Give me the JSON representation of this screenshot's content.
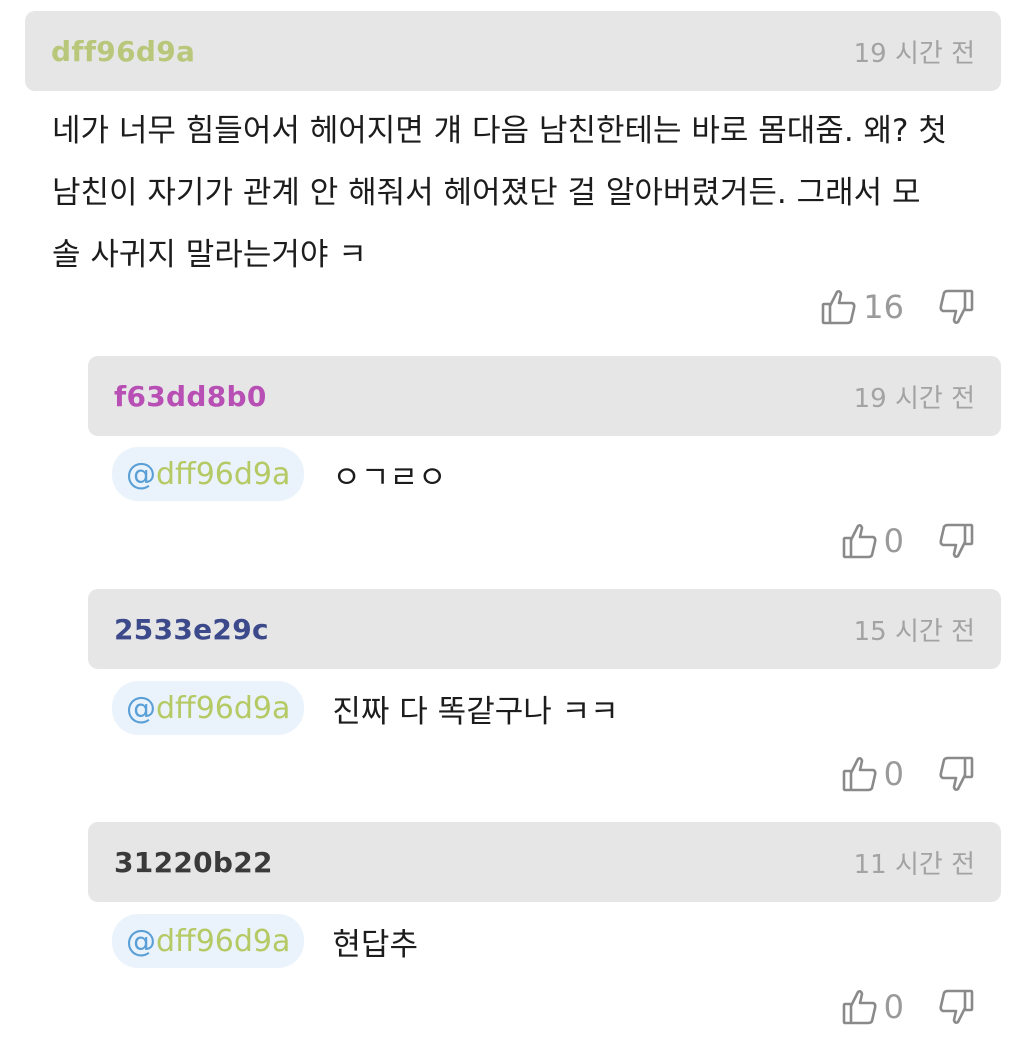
{
  "comments": [
    {
      "username": "dff96d9a",
      "username_color": "#b8c77a",
      "time": "19 시간 전",
      "lines": [
        "네가 너무 힘들어서 헤어지면 걔 다음 남친한테는 바로 몸대줌. 왜? 첫",
        "남친이 자기가 관계 안 해줘서 헤어졌단 걸 알아버렸거든. 그래서 모",
        "솔 사귀지 말라는거야 ㅋ"
      ],
      "likes": "16"
    }
  ],
  "replies": [
    {
      "username": "f63dd8b0",
      "username_color": "#b84fb5",
      "time": "19 시간 전",
      "mention_at": "@",
      "mention_name": "dff96d9a",
      "text": "ㅇㄱㄹㅇ",
      "likes": "0"
    },
    {
      "username": "2533e29c",
      "username_color": "#3c4a8c",
      "time": "15 시간 전",
      "mention_at": "@",
      "mention_name": "dff96d9a",
      "text": "진짜 다 똑같구나 ㅋㅋ",
      "likes": "0"
    },
    {
      "username": "31220b22",
      "username_color": "#3a3a3a",
      "time": "11 시간 전",
      "mention_at": "@",
      "mention_name": "dff96d9a",
      "text": "현답추",
      "likes": "0"
    }
  ],
  "icons": {
    "like": "thumbs-up-icon",
    "dislike": "thumbs-down-icon"
  }
}
